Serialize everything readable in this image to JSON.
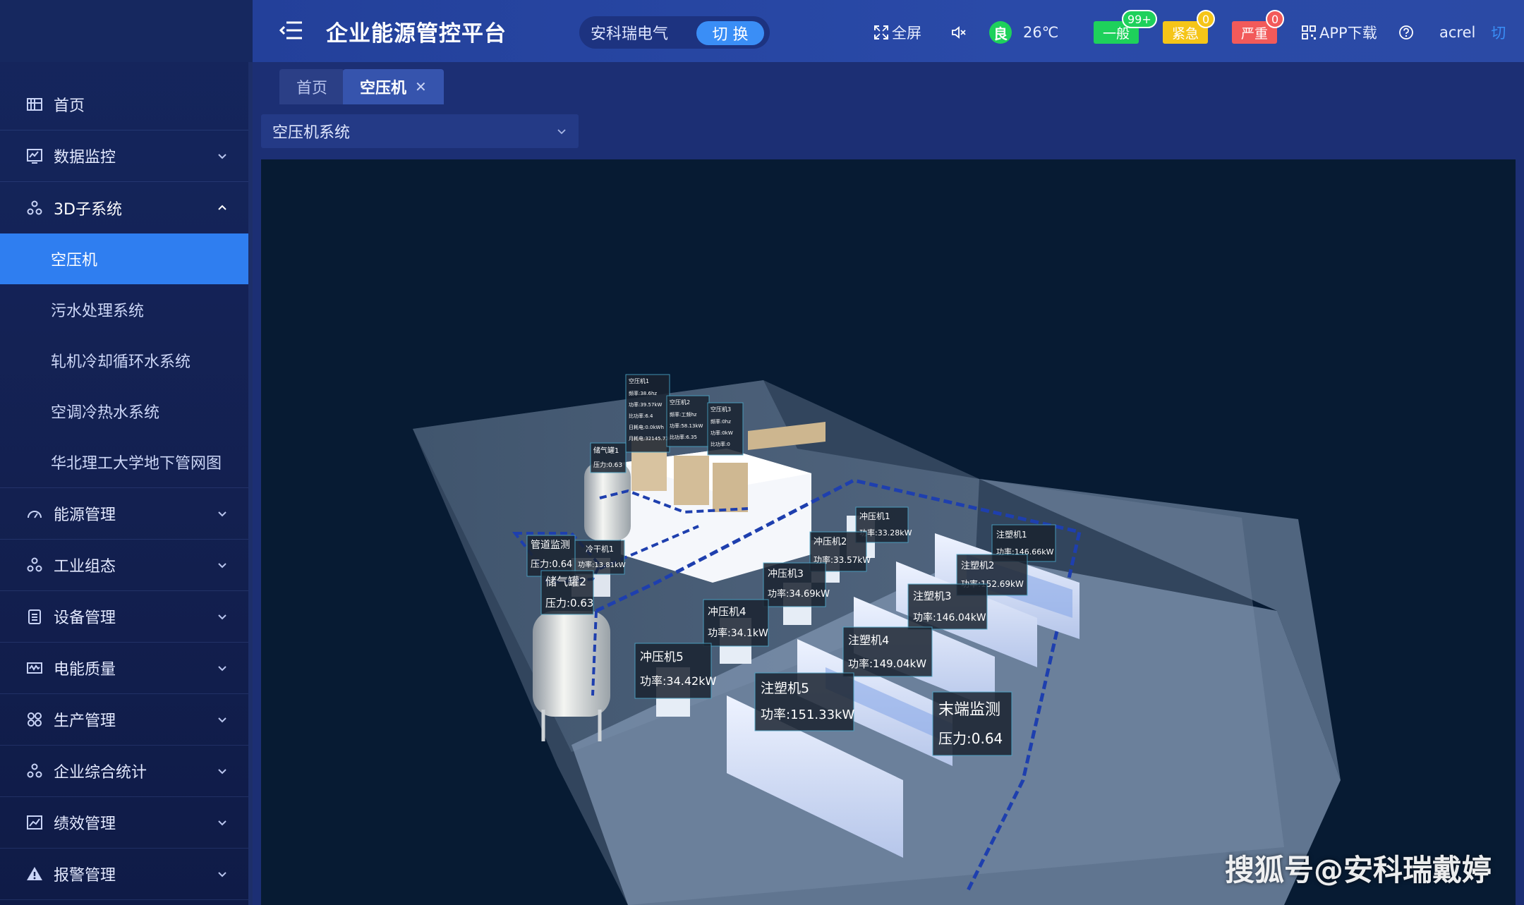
{
  "header": {
    "title": "企业能源管控平台",
    "company": "安科瑞电气",
    "switch_label": "切 换",
    "fullscreen_label": "全屏",
    "air_quality": "良",
    "temperature": "26℃",
    "alarms": [
      {
        "label": "一般",
        "count": "99+",
        "color": "#1ed15b"
      },
      {
        "label": "紧急",
        "count": "0",
        "color": "#f5c518"
      },
      {
        "label": "严重",
        "count": "0",
        "color": "#f25a5a"
      }
    ],
    "app_download": "APP下载",
    "username": "acrel",
    "switch_user": "切"
  },
  "tabs": [
    {
      "label": "首页"
    },
    {
      "label": "空压机"
    }
  ],
  "sidebar": {
    "items": [
      {
        "label": "首页",
        "icon": "home-icon"
      },
      {
        "label": "数据监控",
        "icon": "monitor-icon"
      },
      {
        "label": "3D子系统",
        "icon": "nodes-icon"
      },
      {
        "label": "能源管理",
        "icon": "gauge-icon"
      },
      {
        "label": "工业组态",
        "icon": "nodes-icon"
      },
      {
        "label": "设备管理",
        "icon": "clipboard-icon"
      },
      {
        "label": "电能质量",
        "icon": "wave-icon"
      },
      {
        "label": "生产管理",
        "icon": "grid-icon"
      },
      {
        "label": "企业综合统计",
        "icon": "nodes-icon"
      },
      {
        "label": "绩效管理",
        "icon": "chart-icon"
      },
      {
        "label": "报警管理",
        "icon": "warning-icon"
      }
    ],
    "sub_items": [
      {
        "label": "空压机"
      },
      {
        "label": "污水处理系统"
      },
      {
        "label": "轧机冷却循环水系统"
      },
      {
        "label": "空调冷热水系统"
      },
      {
        "label": "华北理工大学地下管网图"
      }
    ]
  },
  "content": {
    "system_select": "空压机系统",
    "watermark": "搜狐号@安科瑞戴婷"
  },
  "scene_labels": {
    "compressor1_title": "空压机1",
    "compressor1_l1": "频率:38.6hz",
    "compressor1_l2": "功率:39.57kW",
    "compressor1_l3": "比功率:6.4",
    "compressor1_l4": "日耗电:0.0kWh",
    "compressor1_l5": "月耗电:32145.73kWh",
    "compressor2_title": "空压机2",
    "compressor2_l1": "频率:工频hz",
    "compressor2_l2": "功率:58.13kW",
    "compressor2_l3": "比功率:6.35",
    "compressor3_title": "空压机3",
    "compressor3_l1": "频率:0hz",
    "compressor3_l2": "功率:0kW",
    "compressor3_l3": "比功率:0",
    "tank1_title": "储气罐1",
    "tank1_value": "压力:0.63",
    "pipe_title": "管道监测",
    "pipe_value": "压力:0.64",
    "dryer_title": "冷干机1",
    "dryer_value": "功率:13.81kW",
    "tank2_title": "储气罐2",
    "tank2_value": "压力:0.63",
    "press1_title": "冲压机1",
    "press1_value": "功率:33.28kW",
    "press2_title": "冲压机2",
    "press2_value": "功率:33.57kW",
    "press3_title": "冲压机3",
    "press3_value": "功率:34.69kW",
    "press4_title": "冲压机4",
    "press4_value": "功率:34.1kW",
    "press5_title": "冲压机5",
    "press5_value": "功率:34.42kW",
    "mold1_title": "注塑机1",
    "mold1_value": "功率:146.66kW",
    "mold2_title": "注塑机2",
    "mold2_value": "功率:152.69kW",
    "mold3_title": "注塑机3",
    "mold3_value": "功率:146.04kW",
    "mold4_title": "注塑机4",
    "mold4_value": "功率:149.04kW",
    "mold5_title": "注塑机5",
    "mold5_value": "功率:151.33kW",
    "end_title": "末端监测",
    "end_value": "压力:0.64"
  }
}
